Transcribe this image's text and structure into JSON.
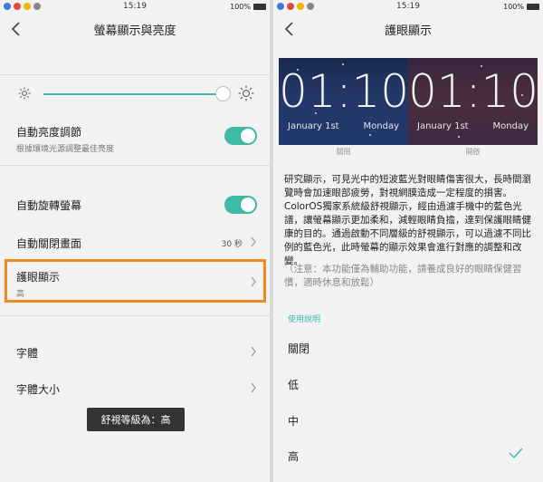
{
  "status_bar": {
    "time": "15:19",
    "battery": "100%"
  },
  "left_screen": {
    "title": "螢幕顯示與亮度",
    "auto_brightness": {
      "title": "自動亮度調節",
      "subtitle": "根據環境光源調整最佳亮度"
    },
    "auto_rotate": {
      "title": "自動旋轉螢幕"
    },
    "auto_off": {
      "title": "自動關閉畫面",
      "value": "30 秒"
    },
    "eye_protect": {
      "title": "護眼顯示",
      "subtitle": "高"
    },
    "font": {
      "title": "字體"
    },
    "font_size": {
      "title": "字體大小"
    },
    "toast": "舒視等級為：高",
    "brightness_level": 0.98
  },
  "right_screen": {
    "title": "護眼顯示",
    "banner": {
      "off": {
        "time": "01:10",
        "date": "January 1st",
        "day": "Monday",
        "caption": "關閉"
      },
      "on": {
        "time": "01:10",
        "date": "January 1st",
        "day": "Monday",
        "caption": "開啟"
      }
    },
    "description": "研究顯示，可見光中的短波藍光對眼睛傷害很大，長時間瀏覽時會加速眼部疲勞，對視網膜造成一定程度的損害。ColorOS獨家系統級舒視顯示，經由過濾手機中的藍色光譜，讓螢幕顯示更加柔和，減輕眼睛負擔，達到保護眼睛健康的目的。通過啟動不同層級的舒視顯示，可以過濾不同比例的藍色光，此時螢幕的顯示效果會進行對應的調整和改變。",
    "note": "（注意：本功能僅為輔助功能，請養成良好的眼睛保健習慣，適時休息和放鬆）",
    "section_label": "使用說明",
    "options": [
      "關閉",
      "低",
      "中",
      "高"
    ],
    "selected": "高"
  },
  "colors": {
    "accent": "#3fbaa5",
    "highlight": "#f08a1d"
  }
}
